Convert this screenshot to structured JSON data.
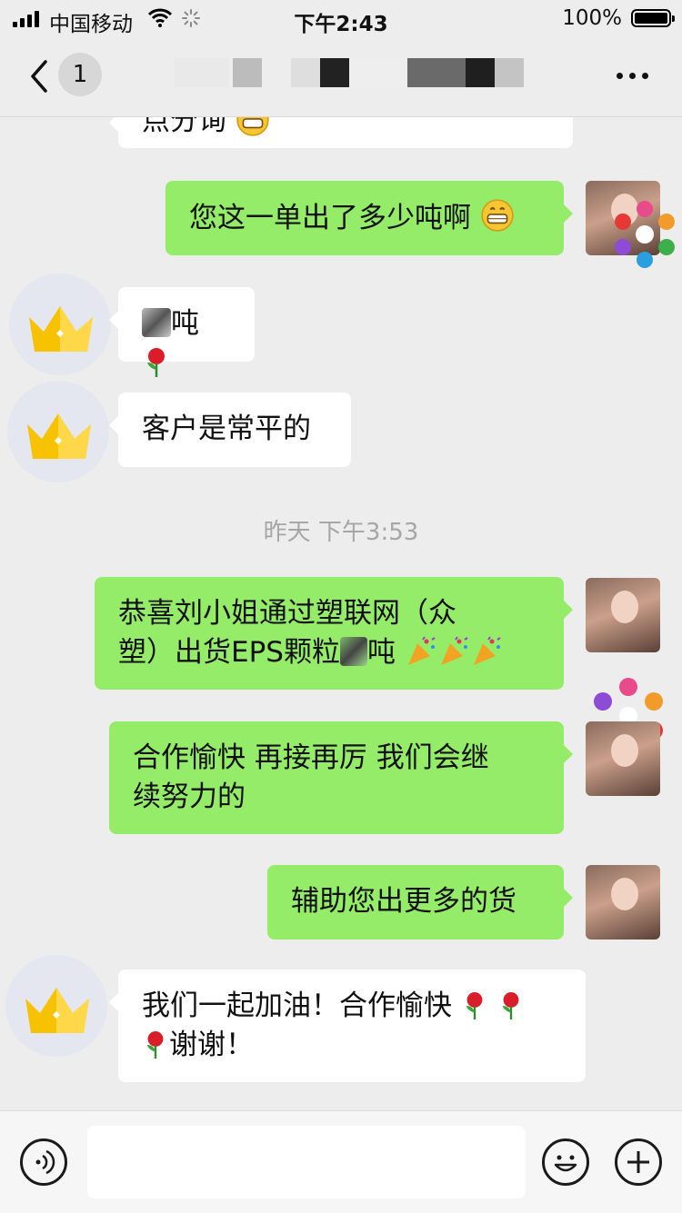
{
  "status_bar": {
    "carrier": "中国移动",
    "time": "下午2:43",
    "battery": "100%"
  },
  "nav": {
    "unread_count": "1",
    "title": ""
  },
  "messages": {
    "m0_tail": "点分询",
    "m1": "您这一单出了多少吨啊",
    "m2": "吨",
    "m3": "客户是常平的",
    "timestamp": "昨天 下午3:53",
    "m4_line1": "恭喜刘小姐通过塑联网（众",
    "m4_line2": "塑）出货EPS颗粒",
    "m4_line2_b": "吨",
    "m5_line1": "合作愉快  再接再厉  我们会继",
    "m5_line2": "续努力的",
    "m6": "辅助您出更多的货",
    "m7_line1": "我们一起加油！合作愉快",
    "m7_line2": "谢谢！"
  },
  "icons": {
    "grin": "grinning-emoji",
    "rose": "rose-emoji",
    "party": "party-popper-emoji",
    "crown": "crown-avatar"
  },
  "colors": {
    "sent_bubble": "#95ec69",
    "received_bubble": "#ffffff",
    "background": "#ededed",
    "crown_gold": "#f4b400"
  }
}
